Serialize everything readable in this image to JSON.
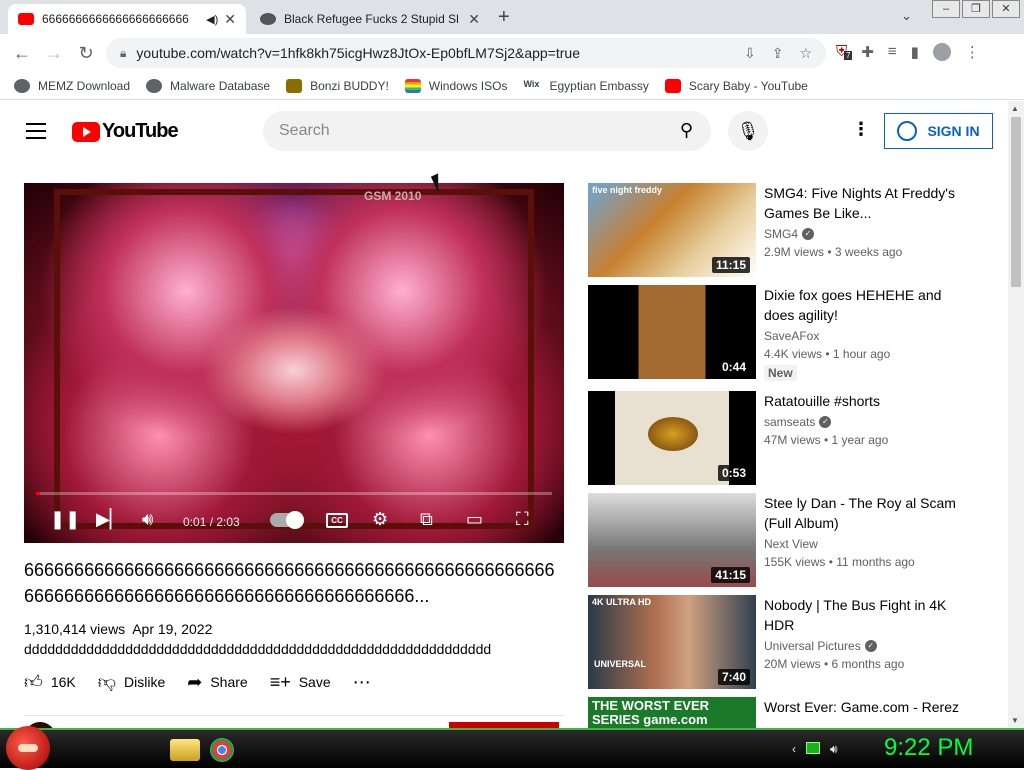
{
  "browser": {
    "tabs": [
      {
        "title": "6666666666666666666666",
        "active": true
      },
      {
        "title": "Black Refugee Fucks 2 Stupid Sl",
        "active": false
      }
    ],
    "url": "youtube.com/watch?v=1hfk8kh75icgHwz8JtOx-Ep0bfLM7Sj2&app=true",
    "extension_badge": "7",
    "bookmarks": [
      {
        "label": "MEMZ Download",
        "color": "#5f6368"
      },
      {
        "label": "Malware Database",
        "color": "#5f6368"
      },
      {
        "label": "Bonzi BUDDY!",
        "color": "#8a6d00"
      },
      {
        "label": "Windows ISOs",
        "color": "#7b2bd8"
      },
      {
        "label": "Egyptian Embassy",
        "color": "#222222"
      },
      {
        "label": "Scary Baby - YouTube",
        "color": "#ff0000"
      }
    ]
  },
  "youtube": {
    "logo_text": "YouTube",
    "search_placeholder": "Search",
    "signin_label": "SIGN IN",
    "player": {
      "watermark": "GSM 2010",
      "time": "0:01 / 2:03",
      "progress_fraction": 0.008,
      "cc_label": "CC"
    },
    "video": {
      "title": "66666666666666666666666666666666666666666666666666666666666666666666666666666666666666666666...",
      "views": "1,310,414 views",
      "date": "Apr 19, 2022",
      "description": "dddddddddddddddddddddddddddddddddddddddddddddddddddddddddddd",
      "likes": "16K",
      "dislike_label": "Dislike",
      "share_label": "Share",
      "save_label": "Save"
    },
    "recommendations": [
      {
        "title": "SMG4: Five Nights At Freddy's Games Be Like...",
        "channel": "SMG4",
        "verified": true,
        "stats": "2.9M views • 3 weeks ago",
        "duration": "11:15",
        "thumb_label": "five night freddy",
        "badge": ""
      },
      {
        "title": "Dixie fox goes HEHEHE and does agility!",
        "channel": "SaveAFox",
        "verified": false,
        "stats": "4.4K views • 1 hour ago",
        "duration": "0:44",
        "thumb_label": "",
        "badge": "New"
      },
      {
        "title": "Ratatouille #shorts",
        "channel": "samseats",
        "verified": true,
        "stats": "47M views • 1 year ago",
        "duration": "0:53",
        "thumb_label": "",
        "badge": ""
      },
      {
        "title": "Stee ly Dan - The Roy al Scam (Full Album)",
        "channel": "Next View",
        "verified": false,
        "stats": "155K views • 11 months ago",
        "duration": "41:15",
        "thumb_label": "",
        "badge": ""
      },
      {
        "title": "Nobody | The Bus Fight in 4K HDR",
        "channel": "Universal Pictures",
        "verified": true,
        "stats": "20M views • 6 months ago",
        "duration": "7:40",
        "thumb_label": "4K ULTRA HD",
        "badge": ""
      },
      {
        "title": "Worst Ever: Game.com - Rerez",
        "channel": "",
        "verified": false,
        "stats": "",
        "duration": "",
        "thumb_label": "THE WORST EVER SERIES game.com",
        "badge": ""
      }
    ]
  },
  "taskbar": {
    "clock": "9:22 PM"
  },
  "colors": {
    "yt_red": "#ff0000",
    "link_blue": "#065fd4",
    "clock_green": "#00ff40"
  }
}
